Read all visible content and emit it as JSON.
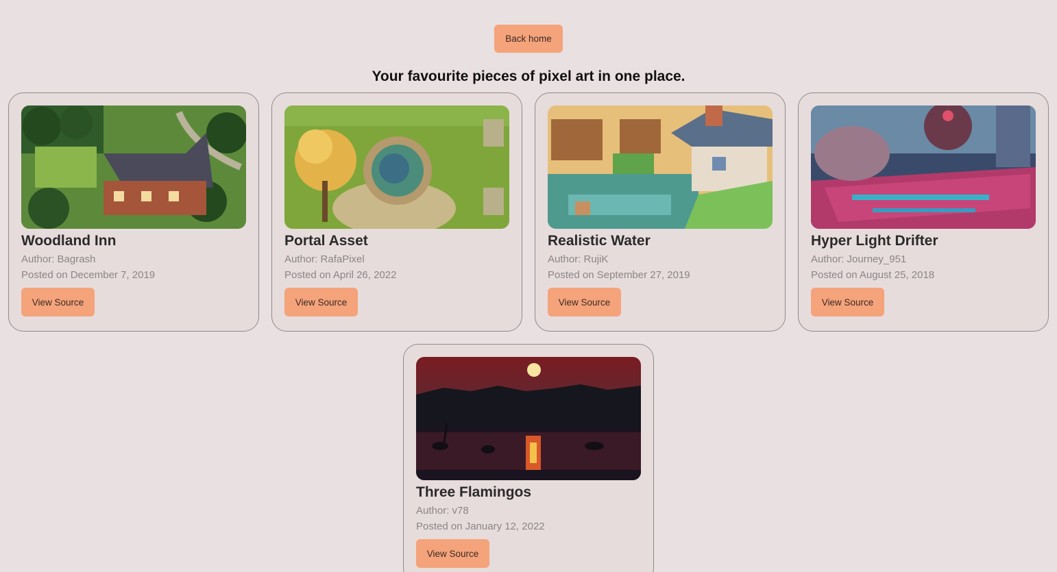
{
  "back_button": "Back home",
  "heading": "Your favourite pieces of pixel art in one place.",
  "cards": [
    {
      "title": "Woodland Inn",
      "author": "Author: Bagrash",
      "date": "Posted on December 7, 2019",
      "button": "View Source"
    },
    {
      "title": "Portal Asset",
      "author": "Author: RafaPixel",
      "date": "Posted on April 26, 2022",
      "button": "View Source"
    },
    {
      "title": "Realistic Water",
      "author": "Author: RujiK",
      "date": "Posted on September 27, 2019",
      "button": "View Source"
    },
    {
      "title": "Hyper Light Drifter",
      "author": "Author: Journey_951",
      "date": "Posted on August 25, 2018",
      "button": "View Source"
    },
    {
      "title": "Three Flamingos",
      "author": "Author: v78",
      "date": "Posted on January 12, 2022",
      "button": "View Source"
    }
  ],
  "colors": {
    "background": "#e9e0e1",
    "button": "#f5a37b"
  }
}
